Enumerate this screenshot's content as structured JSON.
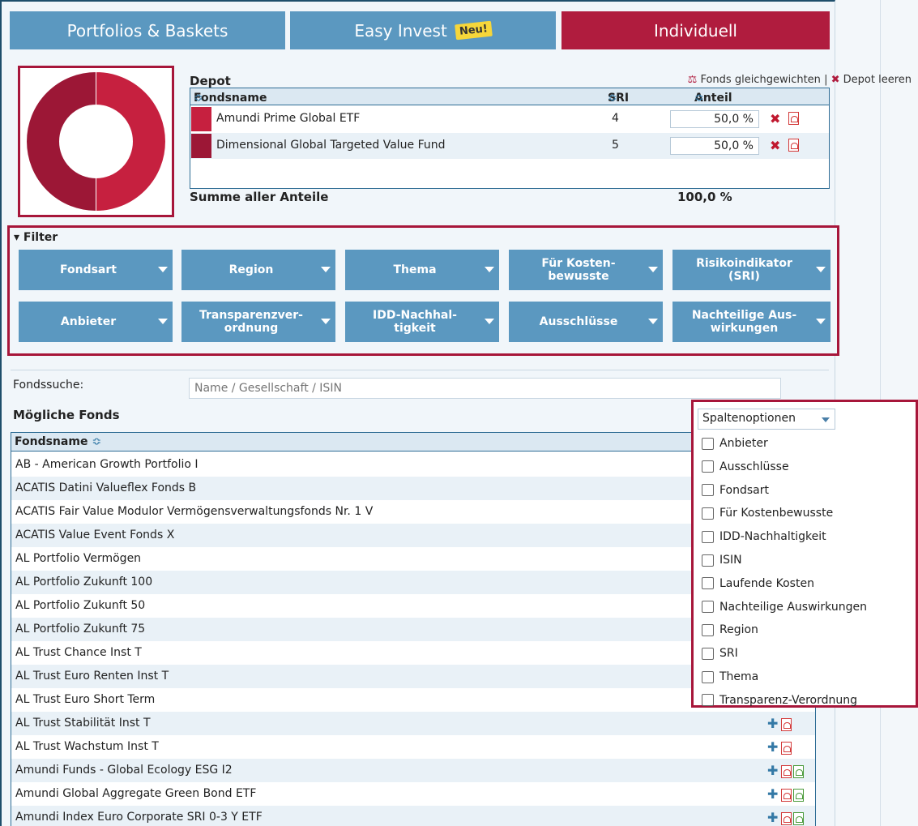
{
  "tabs": [
    {
      "label": "Portfolios & Baskets"
    },
    {
      "label": "Easy Invest",
      "badge": "Neu!"
    },
    {
      "label": "Individuell",
      "active": true
    }
  ],
  "depot": {
    "title": "Depot",
    "equalize_label": "Fonds gleichgewichten",
    "separator": "|",
    "clear_label": "Depot leeren",
    "columns": {
      "name": "Fondsname",
      "sri": "SRI",
      "share": "Anteil"
    },
    "sort_glyph": "≎",
    "rows": [
      {
        "name": "Amundi Prime Global ETF",
        "sri": "4",
        "share": "50,0 %",
        "color": "#c6203f"
      },
      {
        "name": "Dimensional Global Targeted Value Fund",
        "sri": "5",
        "share": "50,0 %",
        "color": "#9c1736"
      }
    ],
    "sum_label": "Summe aller Anteile",
    "sum_value": "100,0 %"
  },
  "allocation_chart": {
    "type": "donut",
    "slices": [
      {
        "label": "Amundi Prime Global ETF",
        "value": 50,
        "color": "#c6203f"
      },
      {
        "label": "Dimensional Global Targeted Value Fund",
        "value": 50,
        "color": "#9c1736"
      }
    ]
  },
  "filter": {
    "title": "▾ Filter",
    "buttons": [
      {
        "label": "Fondsart"
      },
      {
        "label": "Region"
      },
      {
        "label": "Thema"
      },
      {
        "label": "Für Kosten-\nbewusste"
      },
      {
        "label": "Risikoindikator\n(SRI)"
      },
      {
        "label": "Anbieter"
      },
      {
        "label": "Transparenzver-\nordnung"
      },
      {
        "label": "IDD-Nachhal-\ntigkeit"
      },
      {
        "label": "Ausschlüsse"
      },
      {
        "label": "Nachteilige Aus-\nwirkungen"
      }
    ]
  },
  "search": {
    "label": "Fondssuche:",
    "placeholder": "Name / Gesellschaft / ISIN"
  },
  "funds": {
    "title": "Mögliche Fonds",
    "header": "Fondsname",
    "sort_glyph": "≎",
    "rows": [
      {
        "name": "AB - American Growth Portfolio I",
        "pdfs": 0
      },
      {
        "name": "ACATIS Datini Valueflex Fonds B",
        "pdfs": 0
      },
      {
        "name": "ACATIS Fair Value Modulor Vermögensverwaltungsfonds Nr. 1 V",
        "pdfs": 0
      },
      {
        "name": "ACATIS Value Event Fonds X",
        "pdfs": 0
      },
      {
        "name": "AL Portfolio Vermögen",
        "pdfs": 0
      },
      {
        "name": "AL Portfolio Zukunft 100",
        "pdfs": 0
      },
      {
        "name": "AL Portfolio Zukunft 50",
        "pdfs": 0
      },
      {
        "name": "AL Portfolio Zukunft 75",
        "pdfs": 0
      },
      {
        "name": "AL Trust Chance Inst T",
        "pdfs": 0
      },
      {
        "name": "AL Trust Euro Renten Inst T",
        "pdfs": 0
      },
      {
        "name": "AL Trust Euro Short Term",
        "pdfs": 0
      },
      {
        "name": "AL Trust Stabilität Inst T",
        "pdfs": 1
      },
      {
        "name": "AL Trust Wachstum Inst T",
        "pdfs": 1
      },
      {
        "name": "Amundi Funds - Global Ecology ESG I2",
        "pdfs": 2
      },
      {
        "name": "Amundi Global Aggregate Green Bond ETF",
        "pdfs": 2
      },
      {
        "name": "Amundi Index Euro Corporate SRI 0-3 Y ETF",
        "pdfs": 2
      }
    ]
  },
  "column_options": {
    "select_label": "Spaltenoptionen",
    "items": [
      {
        "label": "Anbieter"
      },
      {
        "label": "Ausschlüsse"
      },
      {
        "label": "Fondsart"
      },
      {
        "label": "Für Kostenbewusste"
      },
      {
        "label": "IDD-Nachhaltigkeit"
      },
      {
        "label": "ISIN"
      },
      {
        "label": "Laufende Kosten"
      },
      {
        "label": "Nachteilige Auswirkungen"
      },
      {
        "label": "Region"
      },
      {
        "label": "SRI"
      },
      {
        "label": "Thema"
      },
      {
        "label": "Transparenz-Verordnung"
      }
    ]
  },
  "colors": {
    "tab_blue": "#5b98c0",
    "tab_active": "#b01c3e",
    "highlight_border": "#a7163a",
    "header_bg": "#dbe8f2"
  }
}
